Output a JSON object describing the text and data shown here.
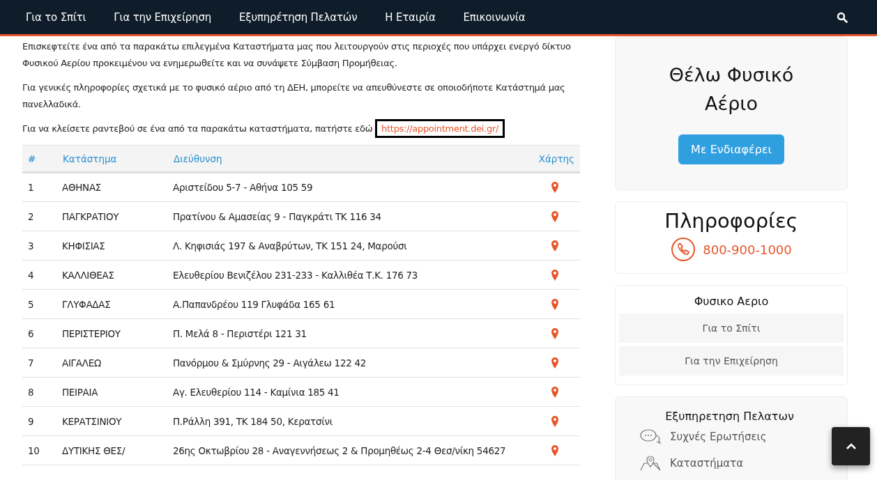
{
  "nav": {
    "items": [
      "Για το Σπίτι",
      "Για την Επιχείρηση",
      "Εξυπηρέτηση Πελατών",
      "Η Εταιρία",
      "Επικοινωνία"
    ]
  },
  "intro": [
    "Επισκεφτείτε ένα από τα παρακάτω επιλεγμένα Καταστήματα μας που λειτουργούν στις περιοχές που υπάρχει ενεργό δίκτυο Φυσικού Αερίου προκειμένου να ενημερωθείτε και να συνάψετε Σύμβαση Προμήθειας.",
    "Για γενικές πληροφορίες σχετικά με το φυσικό αέριο από τη ΔΕΗ, μπορείτε να απευθύνεστε σε οποιοδήποτε Κατάστημά μας πανελλαδικά."
  ],
  "appointment": {
    "text": "Για να κλείσετε ραντεβού σε ένα από τα παρακάτω καταστήματα, πατήστε εδώ",
    "link": "https://appointment.dei.gr/"
  },
  "table": {
    "columns": [
      "#",
      "Κατάστημα",
      "Διεύθυνση",
      "Χάρτης"
    ],
    "rows": [
      {
        "num": "1",
        "store": "ΑΘΗΝΑΣ",
        "address": "Αριστείδου 5-7 - Αθήνα 105 59"
      },
      {
        "num": "2",
        "store": "ΠΑΓΚΡΑΤΙΟΥ",
        "address": "Πρατίνου & Αμασείας 9 - Παγκράτι ΤΚ 116 34"
      },
      {
        "num": "3",
        "store": "ΚΗΦΙΣΙΑΣ",
        "address": "Λ. Κηφισιάς 197 & Αναβρύτων, ΤΚ 151 24, Μαρούσι"
      },
      {
        "num": "4",
        "store": "ΚΑΛΛΙΘΕΑΣ",
        "address": "Ελευθερίου Βενιζέλου 231-233 - Καλλιθέα Τ.Κ. 176 73"
      },
      {
        "num": "5",
        "store": "ΓΛΥΦΑΔΑΣ",
        "address": "Α.Παπανδρέου 119 Γλυφάδα 165 61"
      },
      {
        "num": "6",
        "store": "ΠΕΡΙΣΤΕΡΙΟΥ",
        "address": "Π. Μελά 8 - Περιστέρι 121 31"
      },
      {
        "num": "7",
        "store": "ΑΙΓΑΛΕΩ",
        "address": "Πανόρμου  & Σμύρνης 29 - Αιγάλεω  122 42"
      },
      {
        "num": "8",
        "store": "ΠΕΙΡΑΙΑ",
        "address": "Αγ. Ελευθερίου 114 -  Καμίνια 185 41"
      },
      {
        "num": "9",
        "store": "ΚΕΡΑΤΣΙΝΙΟΥ",
        "address": "Π.Ράλλη 391, ΤΚ 184 50, Κερατσίνι"
      },
      {
        "num": "10",
        "store": "ΔΥΤΙΚΗΣ ΘΕΣ/",
        "address": "26ης Οκτωβρίου 28 - Αναγεννήσεως 2 & Προμηθέως 2-4 Θεσ/νίκη 54627"
      }
    ]
  },
  "sidebar": {
    "interest": {
      "title": "Θέλω Φυσικό Αέριο",
      "button": "Με Ενδιαφέρει"
    },
    "info": {
      "title": "Πληροφορίες",
      "phone": "800-900-1000"
    },
    "gas": {
      "title": "Φυσικο Αεριο",
      "links": [
        "Για το Σπίτι",
        "Για την Επιχείρηση"
      ]
    },
    "service": {
      "title": "Εξυπηρετηση Πελατων",
      "links": [
        {
          "kind": "faq",
          "label": "Συχνές Ερωτήσεις"
        },
        {
          "kind": "stores",
          "label": "Καταστήματα"
        }
      ]
    }
  }
}
